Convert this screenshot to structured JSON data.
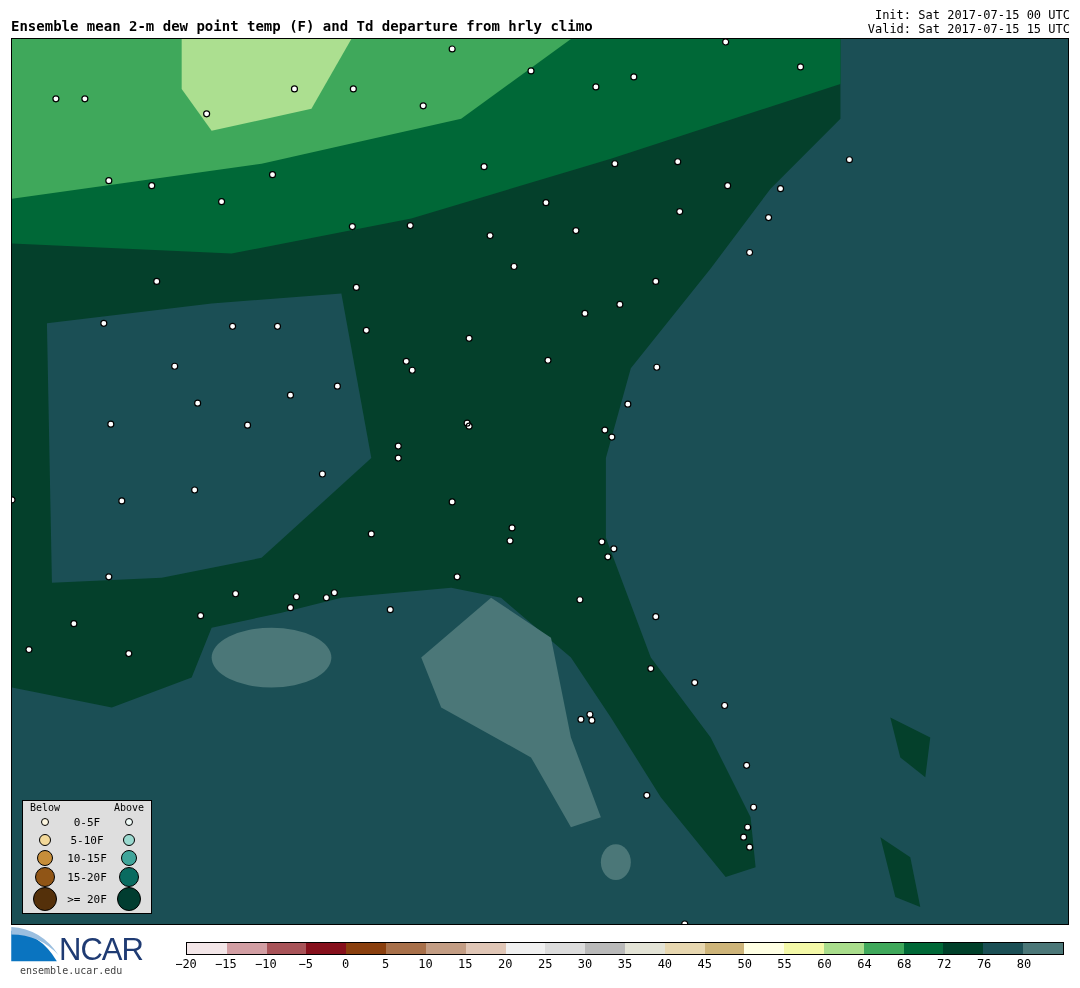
{
  "title": "Ensemble mean 2-m dew point temp (F) and Td departure from hrly climo",
  "init": "Init: Sat 2017-07-15 00 UTC",
  "valid": "Valid: Sat 2017-07-15 15 UTC",
  "legend": {
    "below": "Below",
    "above": "Above",
    "rows": [
      {
        "label": "0-5F",
        "below": {
          "color": "#fdf6e0"
        },
        "above": {
          "color": "#f0fbf8"
        }
      },
      {
        "label": "5-10F",
        "below": {
          "color": "#f3d999"
        },
        "above": {
          "color": "#9ad9cf"
        }
      },
      {
        "label": "10-15F",
        "below": {
          "color": "#c78e3a"
        },
        "above": {
          "color": "#40a59a"
        }
      },
      {
        "label": "15-20F",
        "below": {
          "color": "#905516"
        },
        "above": {
          "color": "#0a6b60"
        }
      },
      {
        "label": ">= 20F",
        "below": {
          "color": "#54300a"
        },
        "above": {
          "color": "#013d30"
        }
      }
    ]
  },
  "logo": {
    "name": "NCAR",
    "url": "ensemble.ucar.edu"
  },
  "colorbar": {
    "segments": [
      {
        "color": "#f3e6e8"
      },
      {
        "color": "#d29ea3"
      },
      {
        "color": "#a85358"
      },
      {
        "color": "#86101c"
      },
      {
        "color": "#8a3f0e"
      },
      {
        "color": "#a8704a"
      },
      {
        "color": "#c39d84"
      },
      {
        "color": "#e0c6b6"
      },
      {
        "color": "#f0f0f0"
      },
      {
        "color": "#dcdcdc"
      },
      {
        "color": "#b9b9b9"
      },
      {
        "color": "#e3e3d6"
      },
      {
        "color": "#e7d7b0"
      },
      {
        "color": "#cdb479"
      },
      {
        "color": "#ffffe3"
      },
      {
        "color": "#f4f9a8"
      },
      {
        "color": "#a9dd8c"
      },
      {
        "color": "#3fa85b"
      },
      {
        "color": "#006837"
      },
      {
        "color": "#00402a"
      },
      {
        "color": "#1b4f55"
      },
      {
        "color": "#4b7778"
      }
    ],
    "ticks": [
      "−20",
      "−15",
      "−10",
      "−5",
      "0",
      "5",
      "10",
      "15",
      "20",
      "25",
      "30",
      "35",
      "40",
      "45",
      "50",
      "55",
      "60",
      "64",
      "68",
      "72",
      "76",
      "80"
    ]
  }
}
